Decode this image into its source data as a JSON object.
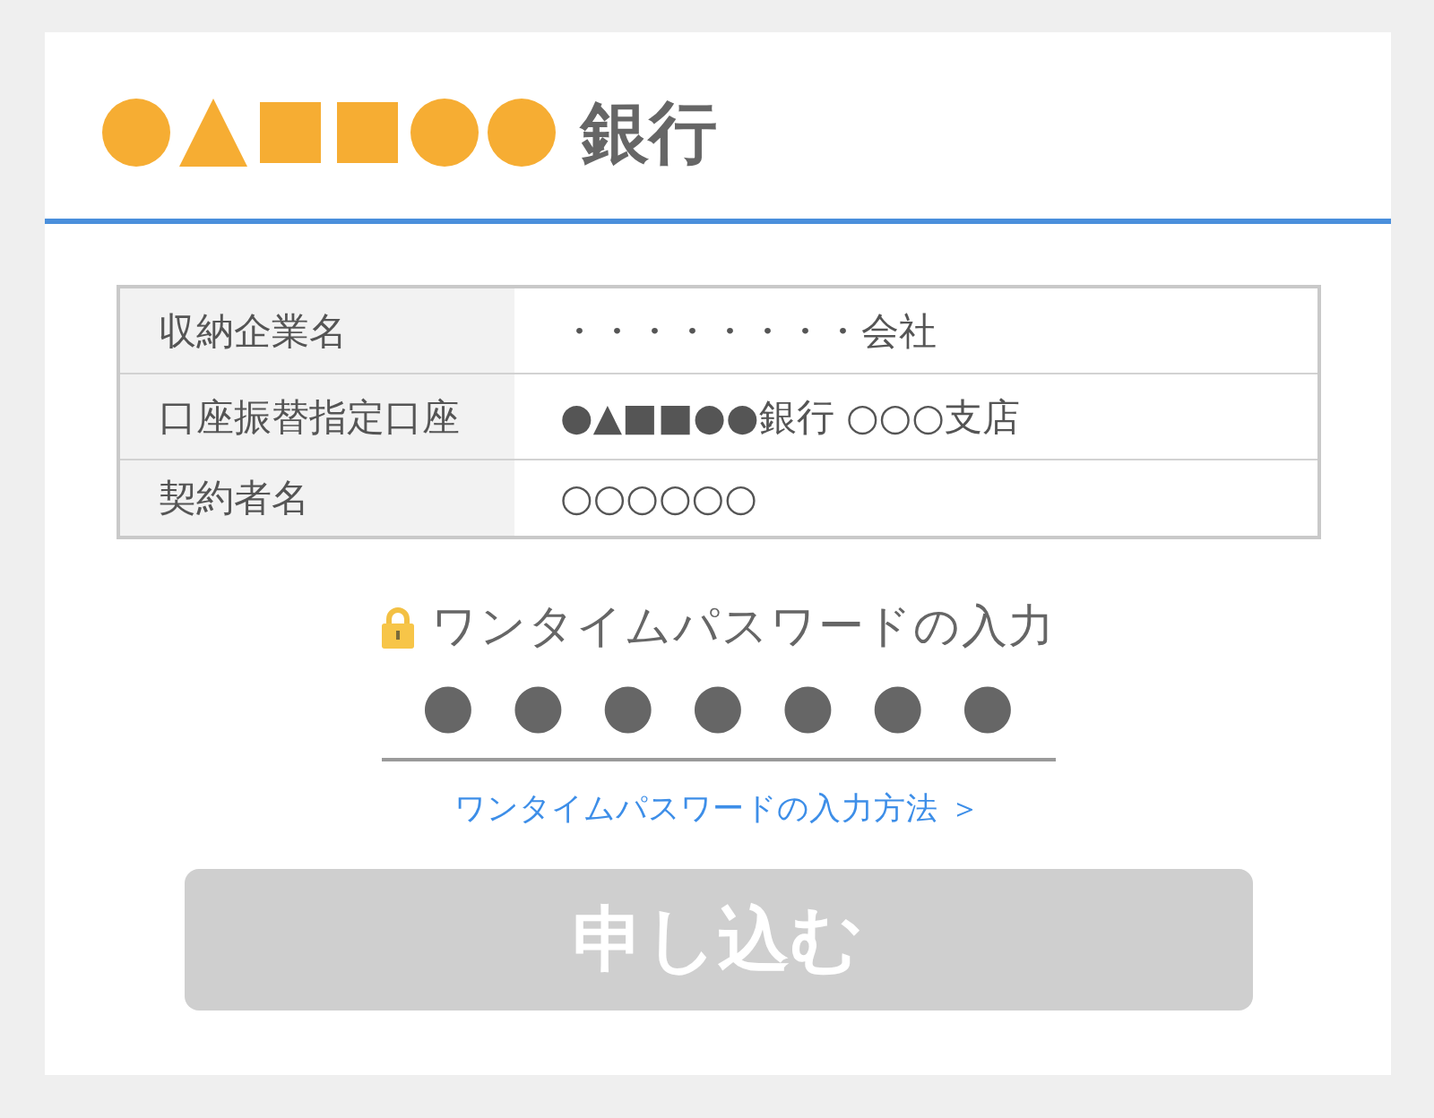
{
  "header": {
    "bank_name": "銀行"
  },
  "table": {
    "rows": [
      {
        "label": "収納企業名",
        "value": "・・・・・・・・会社"
      },
      {
        "label": "口座振替指定口座",
        "value": "●▲■■●●銀行 ○○○支店"
      },
      {
        "label": "契約者名",
        "value": "○○○○○○"
      }
    ]
  },
  "otp": {
    "title": "ワンタイムパスワードの入力",
    "value": "●●●●●●●",
    "help_link": "ワンタイムパスワードの入力方法 ＞"
  },
  "submit": {
    "label": "申し込む",
    "disabled": true
  }
}
